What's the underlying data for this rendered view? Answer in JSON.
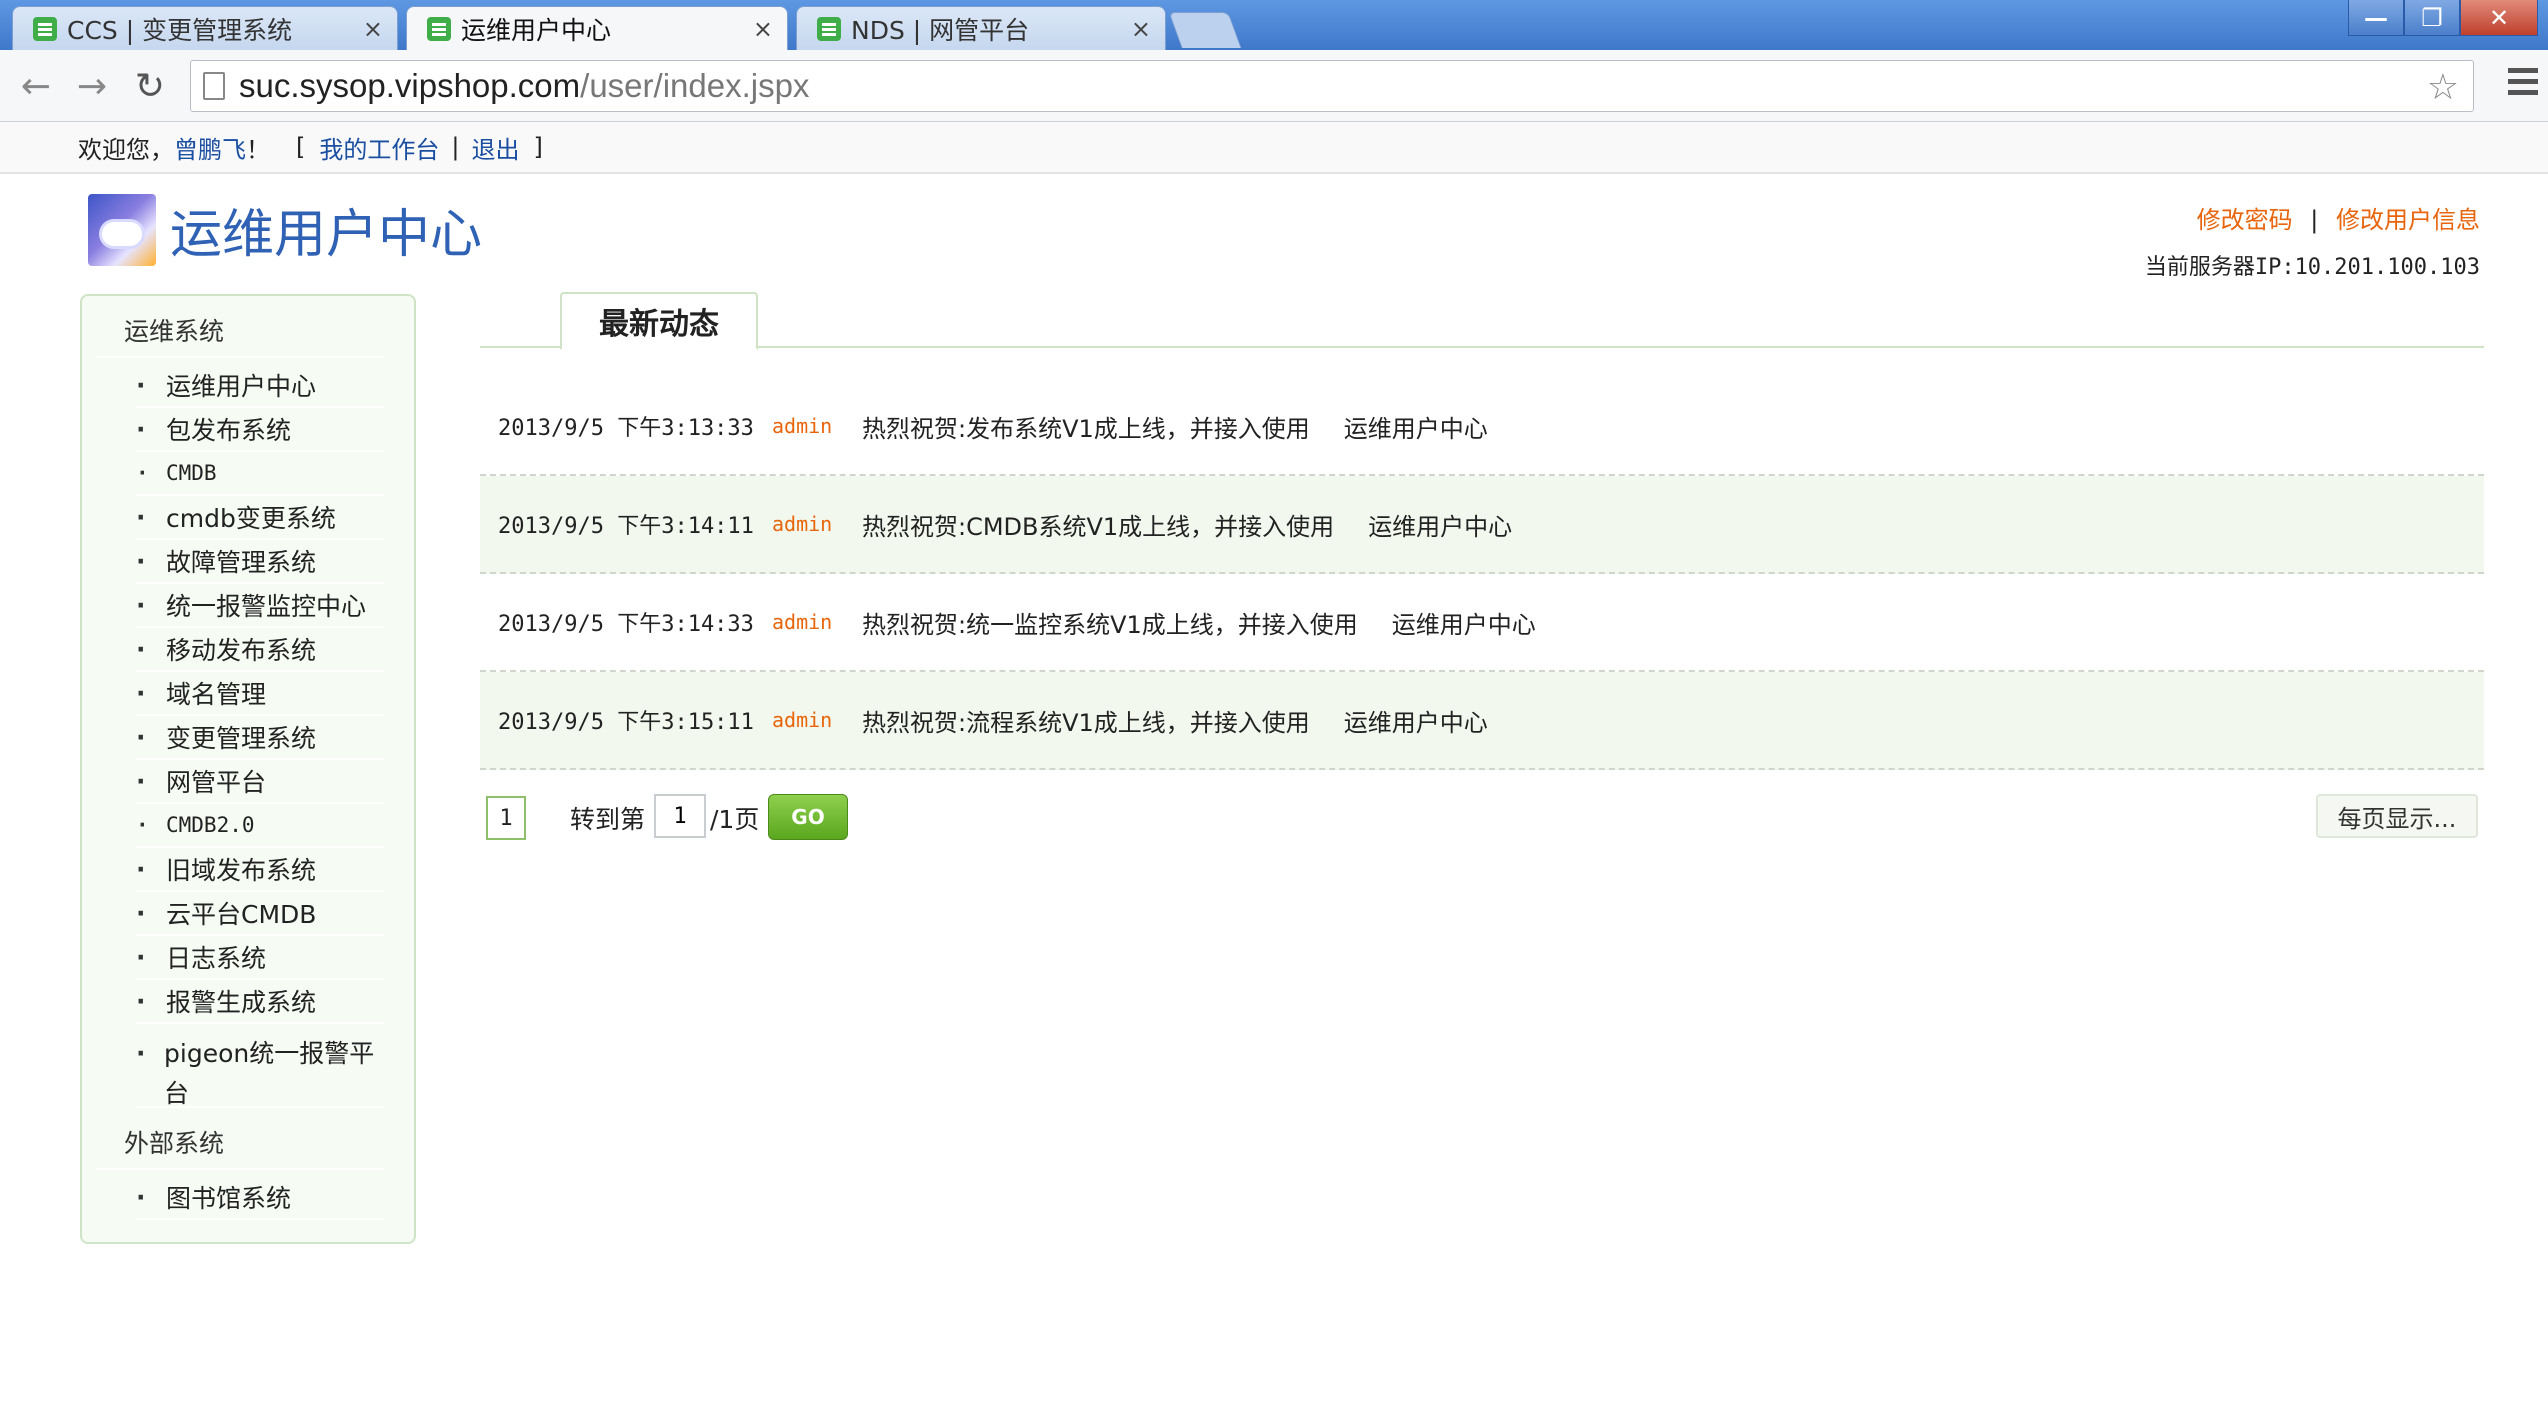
{
  "browser": {
    "tabs": [
      {
        "label": "CCS | 变更管理系统",
        "active": false
      },
      {
        "label": "运维用户中心",
        "active": true
      },
      {
        "label": "NDS | 网管平台",
        "active": false
      }
    ],
    "tab_close": "×",
    "url_host": "suc.sysop.vipshop.com",
    "url_path": "/user/index.jspx",
    "back_glyph": "←",
    "forward_glyph": "→",
    "reload_glyph": "↻",
    "star_glyph": "☆",
    "window": {
      "minimize": "—",
      "restore": "❐",
      "close": "✕"
    }
  },
  "welcome": {
    "prefix": "欢迎您，",
    "user": "曾鹏飞",
    "exclaim": "！",
    "bracket_open": "[",
    "workbench": "我的工作台",
    "divider": "|",
    "logout": "退出",
    "bracket_close": "]"
  },
  "header": {
    "title": "运维用户中心",
    "change_password": "修改密码",
    "divider": "|",
    "change_info": "修改用户信息",
    "server_ip": "当前服务器IP:10.201.100.103"
  },
  "sidebar": {
    "group1": "运维系统",
    "items": [
      "运维用户中心",
      "包发布系统",
      "CMDB",
      "cmdb变更系统",
      "故障管理系统",
      "统一报警监控中心",
      "移动发布系统",
      "域名管理",
      "变更管理系统",
      "网管平台",
      "CMDB2.0",
      "旧域发布系统",
      "云平台CMDB",
      "日志系统",
      "报警生成系统",
      "pigeon统一报警平台"
    ],
    "group2": "外部系统",
    "items2": [
      "图书馆系统"
    ]
  },
  "main": {
    "tab": "最新动态",
    "news": [
      {
        "time": "2013/9/5 下午3:13:33",
        "user": "admin",
        "text": "热烈祝贺:发布系统V1成上线，并接入使用",
        "source": "运维用户中心"
      },
      {
        "time": "2013/9/5 下午3:14:11",
        "user": "admin",
        "text": "热烈祝贺:CMDB系统V1成上线，并接入使用",
        "source": "运维用户中心"
      },
      {
        "time": "2013/9/5 下午3:14:33",
        "user": "admin",
        "text": "热烈祝贺:统一监控系统V1成上线，并接入使用",
        "source": "运维用户中心"
      },
      {
        "time": "2013/9/5 下午3:15:11",
        "user": "admin",
        "text": "热烈祝贺:流程系统V1成上线，并接入使用",
        "source": "运维用户中心"
      }
    ]
  },
  "pager": {
    "current_page": "1",
    "goto_label": "转到第",
    "goto_value": "1",
    "total": "/1页",
    "go": "GO",
    "per_page": "每页显示..."
  },
  "colors": {
    "accent_orange": "#e8650c",
    "link_blue": "#1a4ea1",
    "green_border": "#cfe3c6",
    "go_green": "#6cb82c"
  }
}
